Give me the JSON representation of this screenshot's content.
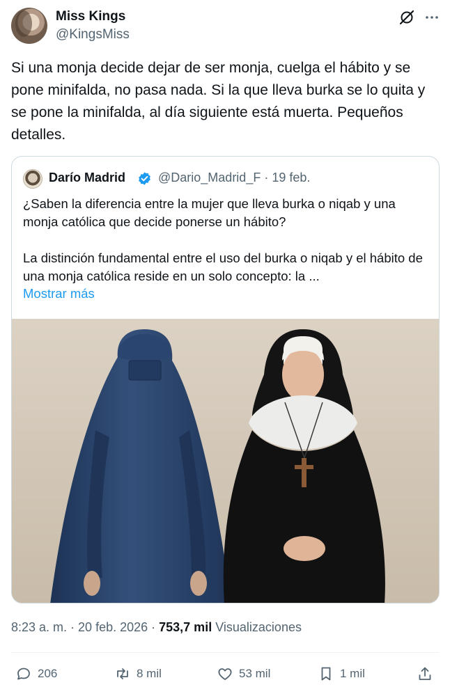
{
  "author": {
    "display_name": "Miss Kings",
    "handle": "@KingsMiss",
    "avatar_icon": "profile-photo"
  },
  "header_icons": [
    "grok-icon",
    "more-icon"
  ],
  "tweet": {
    "text": "Si una monja decide dejar de ser monja, cuelga el hábito y se pone minifalda, no pasa nada. Si la que lleva burka se lo quita y se pone la minifalda, al día siguiente está muerta. Pequeños detalles."
  },
  "quoted": {
    "display_name": "Darío Madrid",
    "handle": "@Dario_Madrid_F",
    "date": "19 feb.",
    "text": "¿Saben la diferencia entre la mujer que lleva burka o niqab y una monja católica que decide ponerse un hábito?\n\nLa distinción fundamental entre el uso del burka o niqab y el hábito de una monja católica reside en un solo concepto: la ...",
    "show_more": "Mostrar más",
    "verified_color": "#1d9bf0"
  },
  "timestamp": {
    "time": "8:23 a. m.",
    "date": "20 feb. 2026",
    "views": "753,7 mil",
    "views_label": "Visualizaciones"
  },
  "actions": {
    "replies": "206",
    "reposts": "8 mil",
    "likes": "53 mil",
    "bookmarks": "1 mil"
  },
  "colors": {
    "text": "#0f1419",
    "secondary": "#536471",
    "link": "#1d9bf0",
    "border": "#cfd9de"
  }
}
